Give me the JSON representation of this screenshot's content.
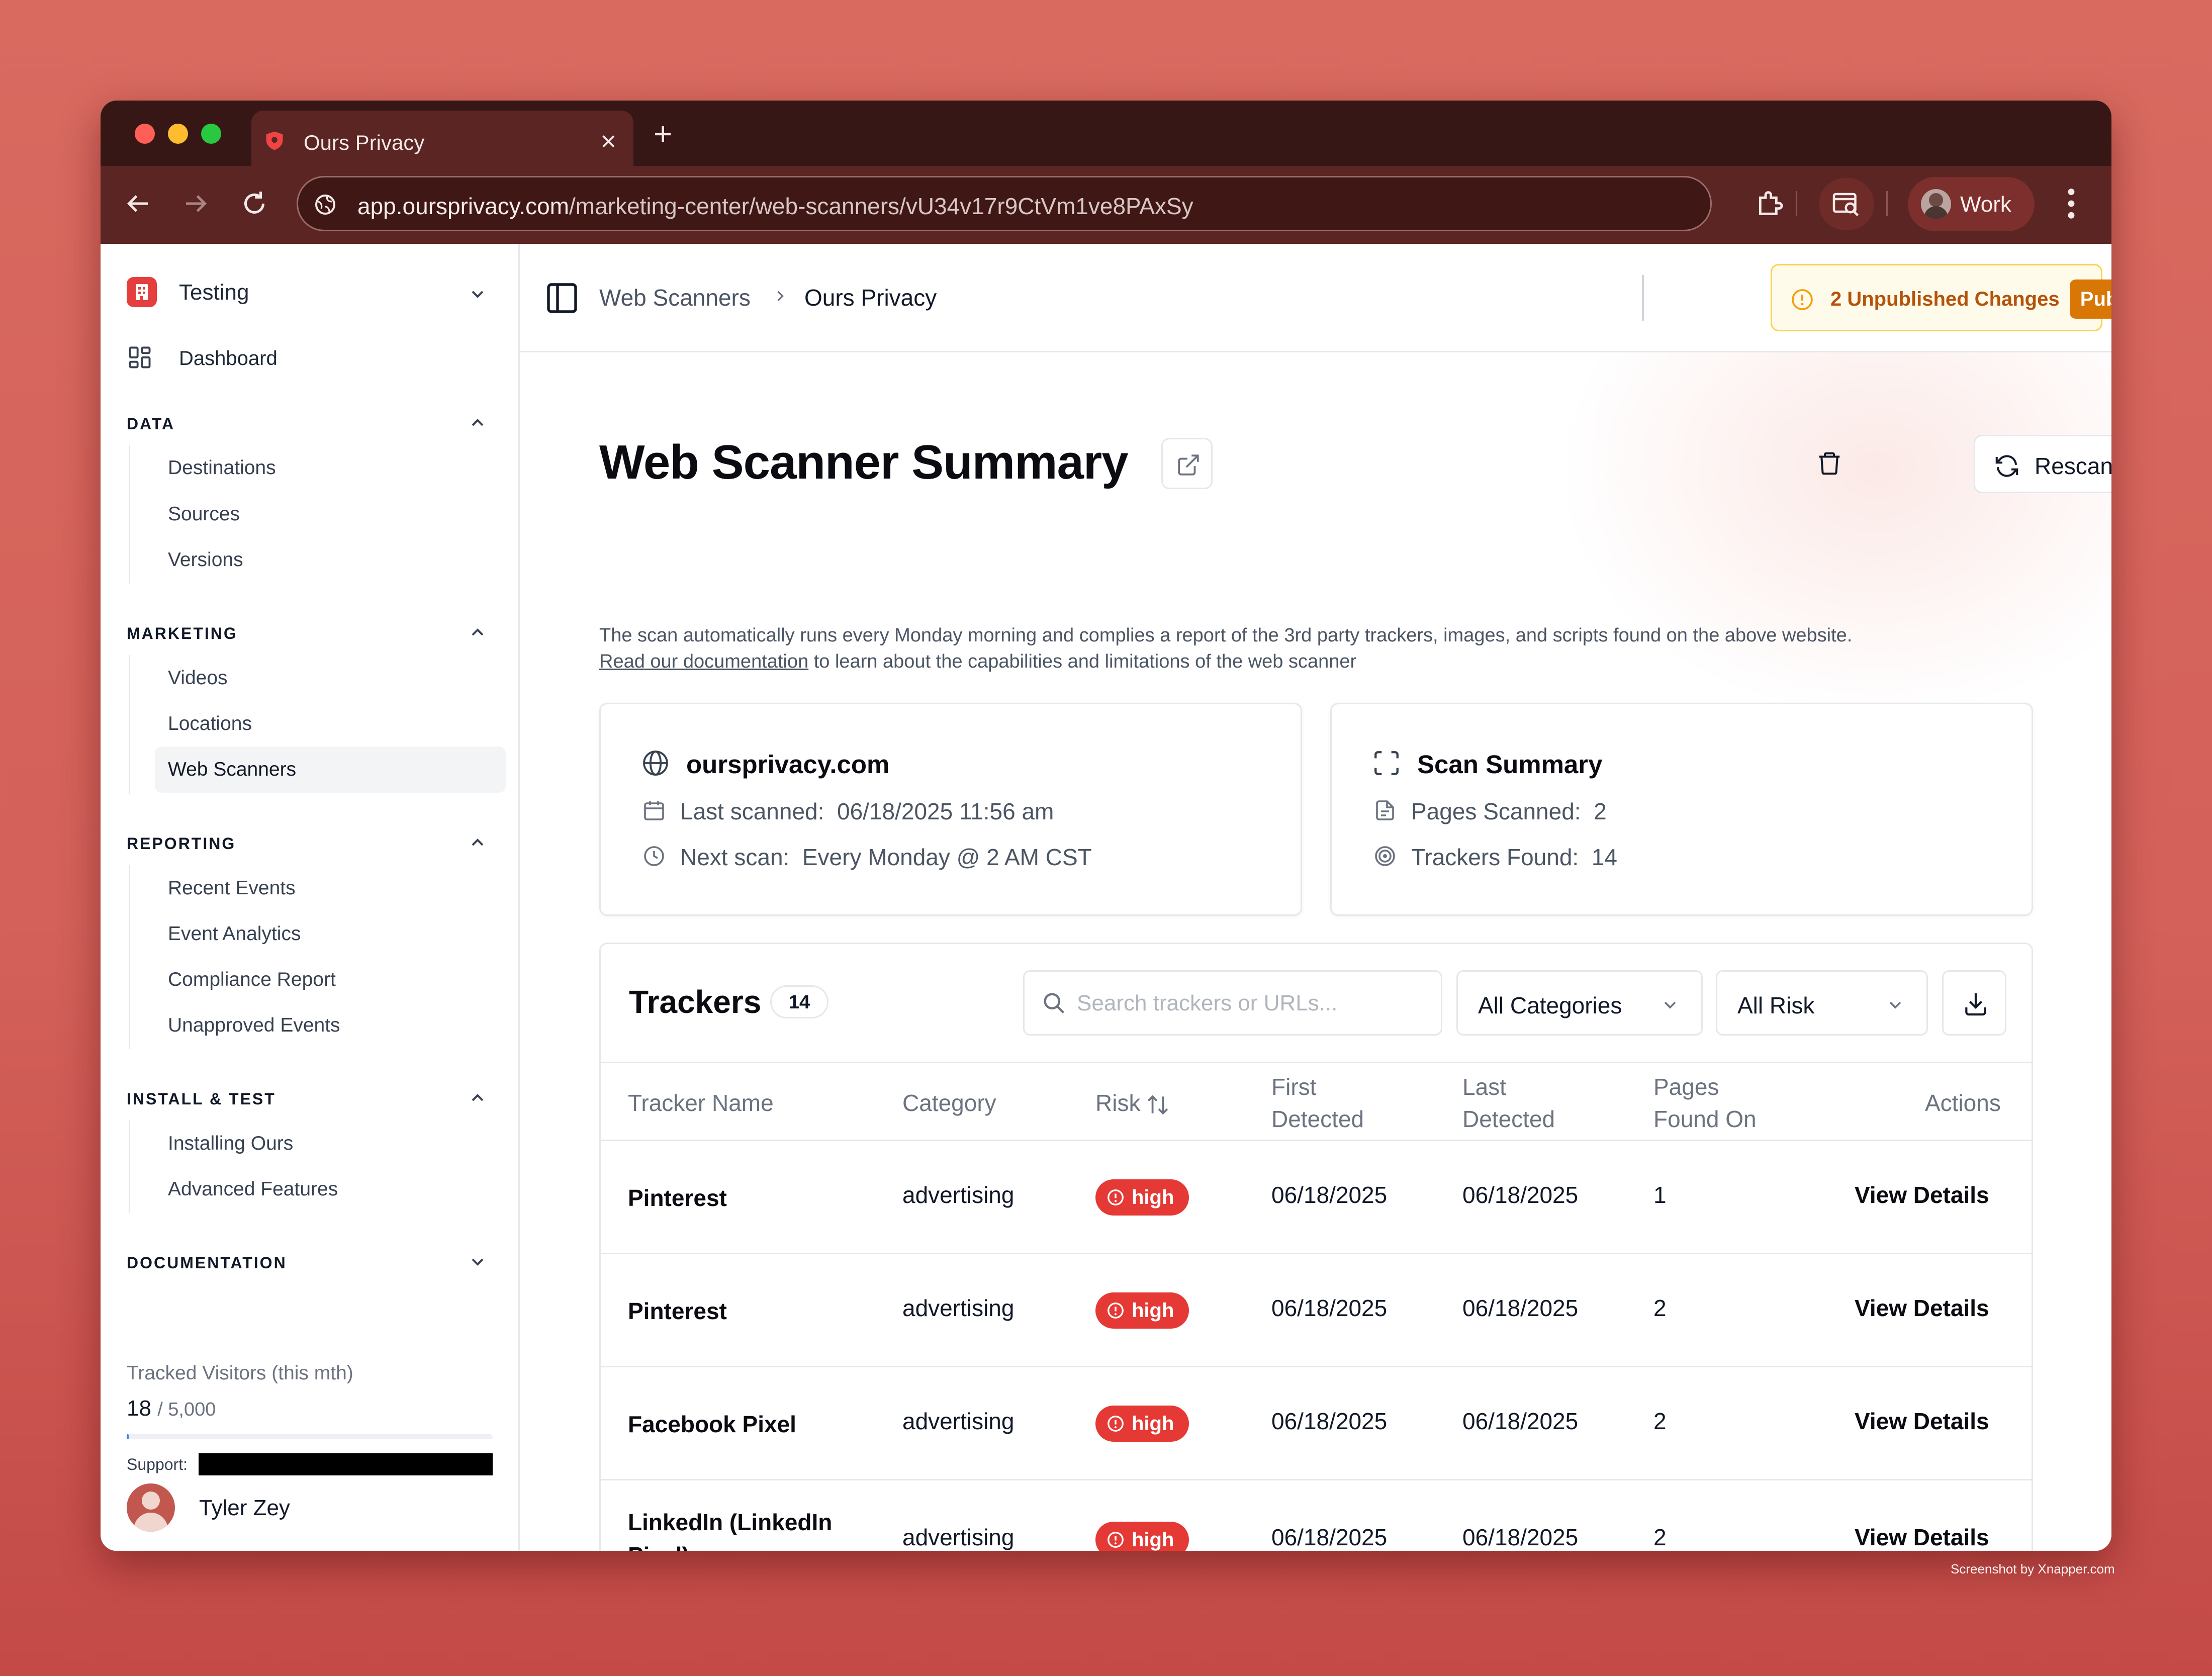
{
  "browser": {
    "tab_title": "Ours Privacy",
    "url_host": "app.oursprivacy.com",
    "url_path": "/marketing-center/web-scanners/vU34v17r9CtVm1ve8PAxSy",
    "profile_label": "Work",
    "traffic_colors": [
      "#ff5f57",
      "#febc2e",
      "#28c840"
    ]
  },
  "sidebar": {
    "workspace": "Testing",
    "dashboard": "Dashboard",
    "sections": [
      {
        "title": "DATA",
        "items": [
          "Destinations",
          "Sources",
          "Versions"
        ]
      },
      {
        "title": "MARKETING",
        "items": [
          "Videos",
          "Locations",
          "Web Scanners"
        ]
      },
      {
        "title": "REPORTING",
        "items": [
          "Recent Events",
          "Event Analytics",
          "Compliance Report",
          "Unapproved Events"
        ]
      },
      {
        "title": "INSTALL & TEST",
        "items": [
          "Installing Ours",
          "Advanced Features"
        ]
      },
      {
        "title": "DOCUMENTATION",
        "items": []
      }
    ],
    "active_item": "Web Scanners",
    "tracked_label": "Tracked Visitors (this mth)",
    "tracked_count": "18",
    "tracked_max": "/ 5,000",
    "tracked_progress": 0.0036,
    "support_label": "Support:",
    "user_name": "Tyler Zey"
  },
  "topbar": {
    "breadcrumb_parent": "Web Scanners",
    "breadcrumb_current": "Ours Privacy",
    "unpublished_text": "2 Unpublished Changes",
    "publish_label": "Publish"
  },
  "page": {
    "title": "Web Scanner Summary",
    "rescan_label": "Rescan",
    "description": "The scan automatically runs every Monday morning and complies a report of the 3rd party trackers, images, and scripts found on the above website.",
    "doc_link": "Read our documentation",
    "description_tail": " to learn about the capabilities and limitations of the web scanner"
  },
  "site_card": {
    "domain": "oursprivacy.com",
    "last_scanned_label": "Last scanned:",
    "last_scanned_value": "06/18/2025 11:56 am",
    "next_scan_label": "Next scan:",
    "next_scan_value": "Every Monday @ 2 AM CST"
  },
  "summary_card": {
    "title": "Scan Summary",
    "pages_label": "Pages Scanned:",
    "pages_value": "2",
    "trackers_label": "Trackers Found:",
    "trackers_value": "14"
  },
  "trackers": {
    "title": "Trackers",
    "count": "14",
    "search_placeholder": "Search trackers or URLs...",
    "category_filter": "All Categories",
    "risk_filter": "All Risk",
    "columns": {
      "name": "Tracker Name",
      "category": "Category",
      "risk": "Risk",
      "first_1": "First",
      "first_2": "Detected",
      "last_1": "Last",
      "last_2": "Detected",
      "pages_1": "Pages",
      "pages_2": "Found On",
      "actions": "Actions"
    },
    "rows": [
      {
        "name": "Pinterest",
        "category": "advertising",
        "risk": "high",
        "first": "06/18/2025",
        "last": "06/18/2025",
        "pages": "1",
        "action": "View Details"
      },
      {
        "name": "Pinterest",
        "category": "advertising",
        "risk": "high",
        "first": "06/18/2025",
        "last": "06/18/2025",
        "pages": "2",
        "action": "View Details"
      },
      {
        "name": "Facebook Pixel",
        "category": "advertising",
        "risk": "high",
        "first": "06/18/2025",
        "last": "06/18/2025",
        "pages": "2",
        "action": "View Details"
      },
      {
        "name": "LinkedIn (LinkedIn Pixel)",
        "category": "advertising",
        "risk": "high",
        "first": "06/18/2025",
        "last": "06/18/2025",
        "pages": "2",
        "action": "View Details"
      }
    ]
  },
  "watermark": "Screenshot by Xnapper.com"
}
